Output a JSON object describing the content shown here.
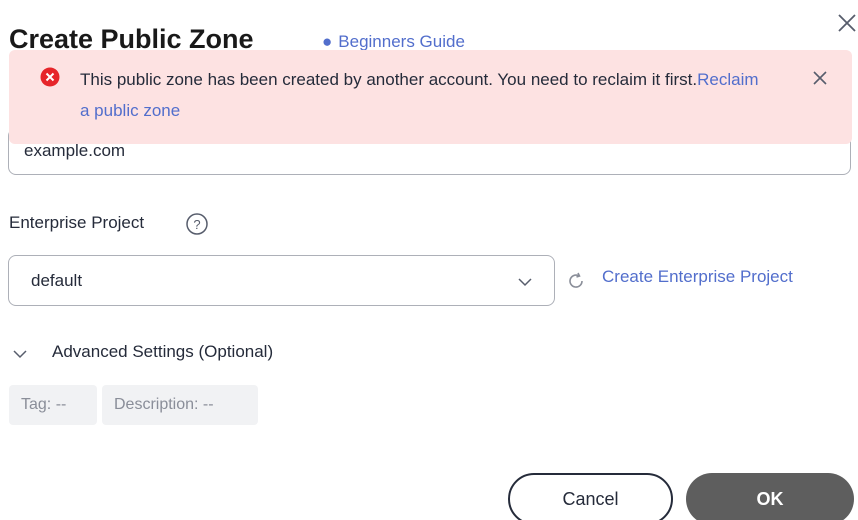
{
  "dialog": {
    "title": "Create Public Zone",
    "guide_link": "Beginners Guide"
  },
  "alert": {
    "message": "This public zone has been created by another account. You need to reclaim it first.",
    "link": "Reclaim a public zone",
    "type_icon": "error-icon"
  },
  "form": {
    "domain_value": "example.com",
    "enterprise_project_label": "Enterprise Project",
    "enterprise_project_value": "default",
    "create_enterprise_project": "Create Enterprise Project",
    "advanced_settings": "Advanced Settings (Optional)",
    "tag": "Tag: --",
    "description": "Description: --"
  },
  "footer": {
    "cancel_label": "Cancel",
    "ok_label": "OK"
  },
  "colors": {
    "link": "#526ecc",
    "alert_bg": "#fde2e2",
    "error": "#e6252a",
    "ok_button": "#5e5e5e"
  }
}
